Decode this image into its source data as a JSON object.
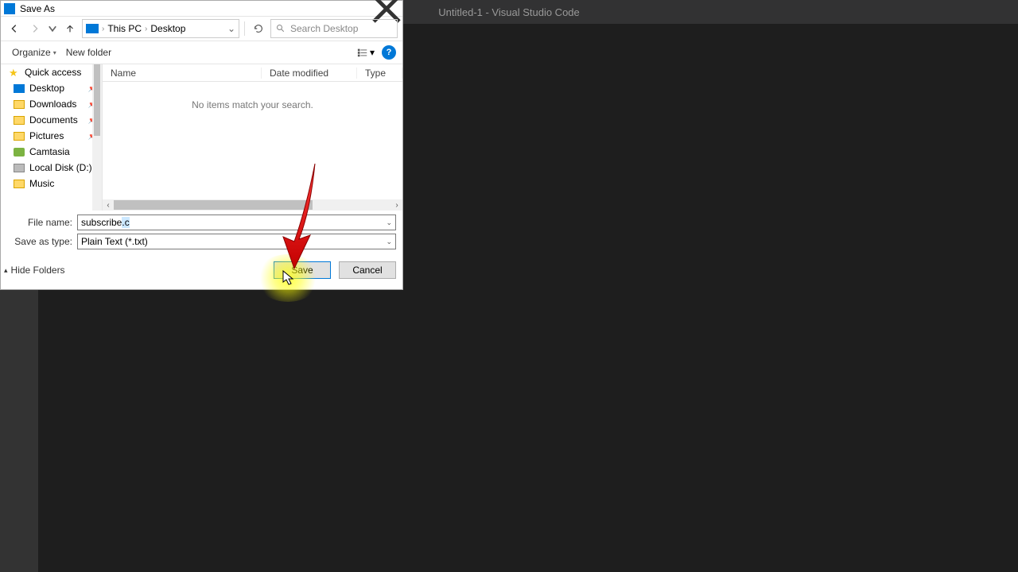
{
  "vscode": {
    "title": "Untitled-1 - Visual Studio Code"
  },
  "dialog": {
    "title": "Save As",
    "breadcrumb": {
      "root": "This PC",
      "folder": "Desktop"
    },
    "search": {
      "placeholder": "Search Desktop"
    },
    "toolbar": {
      "organize": "Organize",
      "newfolder": "New folder"
    },
    "sidebar": {
      "quick": "Quick access",
      "desktop": "Desktop",
      "downloads": "Downloads",
      "documents": "Documents",
      "pictures": "Pictures",
      "camtasia": "Camtasia",
      "disk": "Local Disk (D:)",
      "music": "Music"
    },
    "columns": {
      "name": "Name",
      "date": "Date modified",
      "type": "Type"
    },
    "empty": "No items match your search.",
    "filename_label": "File name:",
    "filename_value_base": "subscribe",
    "filename_value_ext": ".c",
    "type_label": "Save as type:",
    "type_value": "Plain Text (*.txt)",
    "hide_folders": "Hide Folders",
    "save": "Save",
    "cancel": "Cancel"
  }
}
